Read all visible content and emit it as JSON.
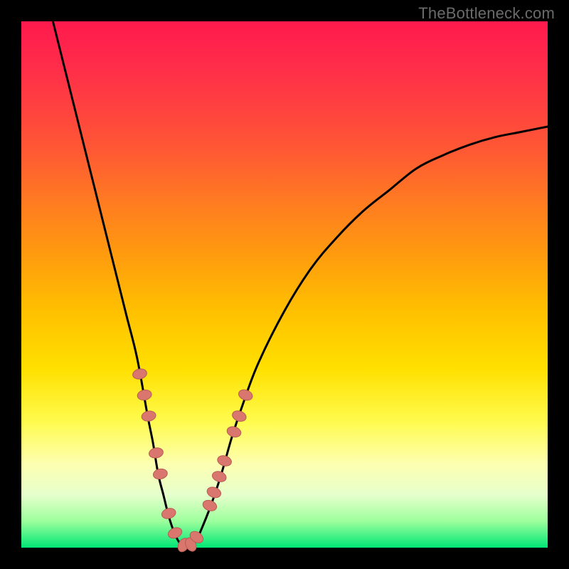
{
  "watermark": "TheBottleneck.com",
  "colors": {
    "frame_bg": "#000000",
    "gradient_top": "#ff1a4d",
    "gradient_bottom": "#00e676",
    "curve_stroke": "#000000",
    "marker_fill": "#d9766e",
    "marker_stroke": "#b85c54"
  },
  "chart_data": {
    "type": "line",
    "title": "",
    "xlabel": "",
    "ylabel": "",
    "xlim": [
      0,
      100
    ],
    "ylim": [
      0,
      100
    ],
    "grid": false,
    "legend_position": "none",
    "series": [
      {
        "name": "bottleneck-curve",
        "x": [
          6,
          8,
          10,
          12,
          14,
          16,
          18,
          20,
          22,
          24,
          25,
          26,
          27,
          28,
          29,
          30,
          31,
          32,
          33,
          34,
          36,
          38,
          40,
          42,
          45,
          50,
          55,
          60,
          65,
          70,
          75,
          80,
          85,
          90,
          95,
          100
        ],
        "y": [
          100,
          92,
          84,
          76,
          68,
          60,
          52,
          44,
          36,
          25,
          20,
          14,
          10,
          6,
          3,
          1,
          0,
          0,
          1,
          3,
          8,
          14,
          21,
          27,
          35,
          45,
          53,
          59,
          64,
          68,
          72,
          74.5,
          76.5,
          78,
          79,
          80
        ]
      }
    ],
    "markers": {
      "name": "highlight-points",
      "x": [
        22.5,
        23.4,
        24.2,
        25.6,
        26.4,
        28.0,
        29.2,
        30.8,
        32.2,
        33.3,
        35.8,
        36.6,
        37.6,
        38.6,
        40.4,
        41.4,
        42.6
      ],
      "y": [
        33,
        29,
        25,
        18,
        14,
        6.5,
        2.8,
        0.5,
        0.6,
        2,
        8,
        10.5,
        13.5,
        16.5,
        22,
        25,
        29
      ]
    },
    "annotations": []
  }
}
